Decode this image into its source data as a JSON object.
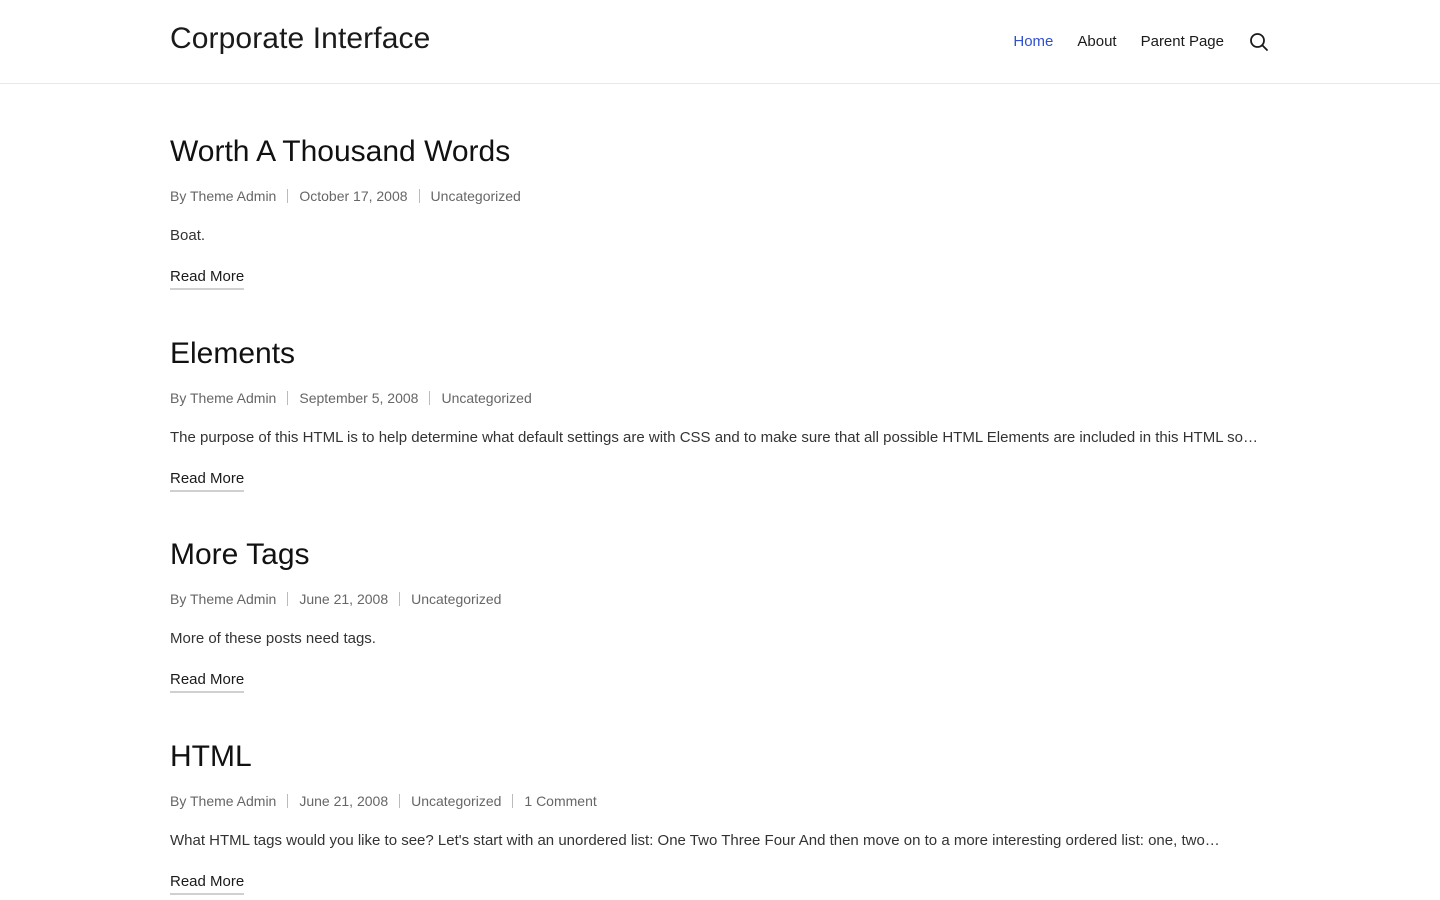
{
  "header": {
    "site_title": "Corporate Interface",
    "nav": [
      {
        "label": "Home",
        "current": true
      },
      {
        "label": "About"
      },
      {
        "label": "Parent Page"
      }
    ],
    "search_icon": "search-icon"
  },
  "posts": [
    {
      "title": "Worth A Thousand Words",
      "author": "By Theme Admin",
      "date": "October 17, 2008",
      "category": "Uncategorized",
      "excerpt": "Boat.",
      "read_more": "Read More"
    },
    {
      "title": "Elements",
      "author": "By Theme Admin",
      "date": "September 5, 2008",
      "category": "Uncategorized",
      "excerpt": "The purpose of this HTML is to help determine what default settings are with CSS and to make sure that all possible HTML Elements are included in this HTML so…",
      "read_more": "Read More"
    },
    {
      "title": "More Tags",
      "author": "By Theme Admin",
      "date": "June 21, 2008",
      "category": "Uncategorized",
      "excerpt": "More of these posts need tags.",
      "read_more": "Read More"
    },
    {
      "title": "HTML",
      "author": "By Theme Admin",
      "date": "June 21, 2008",
      "category": "Uncategorized",
      "comments": "1 Comment",
      "excerpt": "What HTML tags would you like to see? Let's start with an unordered list: One Two Three Four And then move on to a more interesting ordered list: one, two…",
      "read_more": "Read More"
    }
  ],
  "colors": {
    "accent": "#3050d0",
    "text": "#1a1a1a",
    "meta": "#666666"
  }
}
